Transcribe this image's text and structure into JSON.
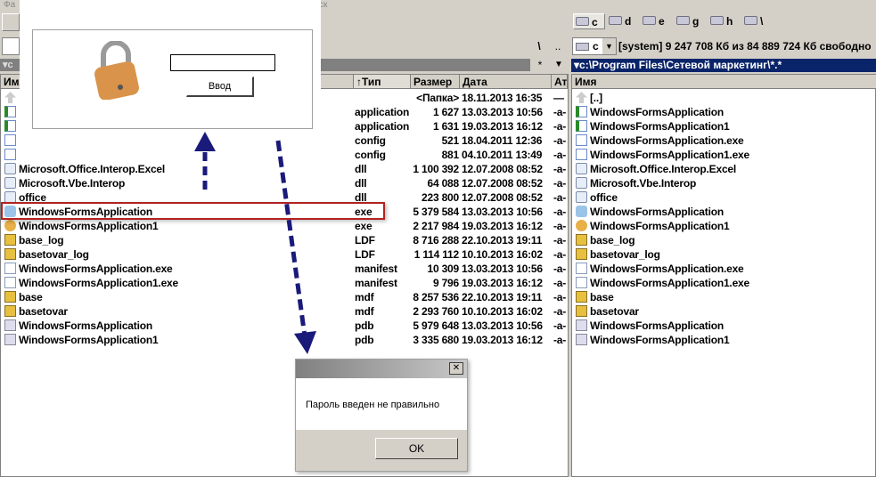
{
  "menubar": {
    "left": "Фа",
    "right": "ск"
  },
  "right_drives": [
    {
      "label": "c"
    },
    {
      "label": "d"
    },
    {
      "label": "e"
    },
    {
      "label": "g"
    },
    {
      "label": "h"
    },
    {
      "label": "\\"
    }
  ],
  "left_path_buttons": {
    "root": "\\",
    "up": ".."
  },
  "left_path_header": {
    "drive": "c",
    "filter": "*"
  },
  "right_drive_select": {
    "value": "c",
    "info": "[system]  9 247 708 Кб из 84 889 724 Кб свободно"
  },
  "right_path": "c:\\Program Files\\Сетевой маркетинг\\*.*",
  "left_columns": {
    "name": "Имя",
    "type": "↑Тип",
    "size": "Размер",
    "date": "Дата",
    "attr": "Ат"
  },
  "right_columns": {
    "name": "Имя"
  },
  "left_files": [
    {
      "name": "",
      "type": "",
      "size": "<Папка>",
      "date": "18.11.2013 16:35",
      "attr": "—",
      "icon": "up-folder"
    },
    {
      "name": "",
      "type": "application",
      "size": "1 627",
      "date": "13.03.2013 10:56",
      "attr": "-a-",
      "icon": "application"
    },
    {
      "name": "",
      "type": "application",
      "size": "1 631",
      "date": "19.03.2013 16:12",
      "attr": "-a-",
      "icon": "application"
    },
    {
      "name": "",
      "type": "config",
      "size": "521",
      "date": "18.04.2011 12:36",
      "attr": "-a-",
      "icon": "config"
    },
    {
      "name": "",
      "type": "config",
      "size": "881",
      "date": "04.10.2011 13:49",
      "attr": "-a-",
      "icon": "config"
    },
    {
      "name": "Microsoft.Office.Interop.Excel",
      "type": "dll",
      "size": "1 100 392",
      "date": "12.07.2008 08:52",
      "attr": "-a-",
      "icon": "dll"
    },
    {
      "name": "Microsoft.Vbe.Interop",
      "type": "dll",
      "size": "64 088",
      "date": "12.07.2008 08:52",
      "attr": "-a-",
      "icon": "dll"
    },
    {
      "name": "office",
      "type": "dll",
      "size": "223 800",
      "date": "12.07.2008 08:52",
      "attr": "-a-",
      "icon": "dll"
    },
    {
      "name": "WindowsFormsApplication",
      "type": "exe",
      "size": "5 379 584",
      "date": "13.03.2013 10:56",
      "attr": "-a-",
      "icon": "exe"
    },
    {
      "name": "WindowsFormsApplication1",
      "type": "exe",
      "size": "2 217 984",
      "date": "19.03.2013 16:12",
      "attr": "-a-",
      "icon": "exe-lock"
    },
    {
      "name": "base_log",
      "type": "LDF",
      "size": "8 716 288",
      "date": "22.10.2013 19:11",
      "attr": "-a-",
      "icon": "db"
    },
    {
      "name": "basetovar_log",
      "type": "LDF",
      "size": "1 114 112",
      "date": "10.10.2013 16:02",
      "attr": "-a-",
      "icon": "db"
    },
    {
      "name": "WindowsFormsApplication.exe",
      "type": "manifest",
      "size": "10 309",
      "date": "13.03.2013 10:56",
      "attr": "-a-",
      "icon": "file"
    },
    {
      "name": "WindowsFormsApplication1.exe",
      "type": "manifest",
      "size": "9 796",
      "date": "19.03.2013 16:12",
      "attr": "-a-",
      "icon": "file"
    },
    {
      "name": "base",
      "type": "mdf",
      "size": "8 257 536",
      "date": "22.10.2013 19:11",
      "attr": "-a-",
      "icon": "db"
    },
    {
      "name": "basetovar",
      "type": "mdf",
      "size": "2 293 760",
      "date": "10.10.2013 16:02",
      "attr": "-a-",
      "icon": "db"
    },
    {
      "name": "WindowsFormsApplication",
      "type": "pdb",
      "size": "5 979 648",
      "date": "13.03.2013 10:56",
      "attr": "-a-",
      "icon": "pdb"
    },
    {
      "name": "WindowsFormsApplication1",
      "type": "pdb",
      "size": "3 335 680",
      "date": "19.03.2013 16:12",
      "attr": "-a-",
      "icon": "pdb"
    }
  ],
  "right_files": [
    {
      "name": "[..]",
      "icon": "up-folder"
    },
    {
      "name": "WindowsFormsApplication",
      "icon": "application"
    },
    {
      "name": "WindowsFormsApplication1",
      "icon": "application"
    },
    {
      "name": "WindowsFormsApplication.exe",
      "icon": "config"
    },
    {
      "name": "WindowsFormsApplication1.exe",
      "icon": "config"
    },
    {
      "name": "Microsoft.Office.Interop.Excel",
      "icon": "dll"
    },
    {
      "name": "Microsoft.Vbe.Interop",
      "icon": "dll"
    },
    {
      "name": "office",
      "icon": "dll"
    },
    {
      "name": "WindowsFormsApplication",
      "icon": "exe"
    },
    {
      "name": "WindowsFormsApplication1",
      "icon": "exe-lock"
    },
    {
      "name": "base_log",
      "icon": "db"
    },
    {
      "name": "basetovar_log",
      "icon": "db"
    },
    {
      "name": "WindowsFormsApplication.exe",
      "icon": "file"
    },
    {
      "name": "WindowsFormsApplication1.exe",
      "icon": "file"
    },
    {
      "name": "base",
      "icon": "db"
    },
    {
      "name": "basetovar",
      "icon": "db"
    },
    {
      "name": "WindowsFormsApplication",
      "icon": "pdb"
    },
    {
      "name": "WindowsFormsApplication1",
      "icon": "pdb"
    }
  ],
  "login_dialog": {
    "password_value": "",
    "button": "Ввод"
  },
  "message_box": {
    "text": "Пароль введен не правильно",
    "ok": "OK",
    "close": "✕"
  },
  "colors": {
    "path_active": "#0a246a",
    "path_inactive": "#808080",
    "highlight": "#b22222",
    "arrow": "#1a1a7a"
  }
}
